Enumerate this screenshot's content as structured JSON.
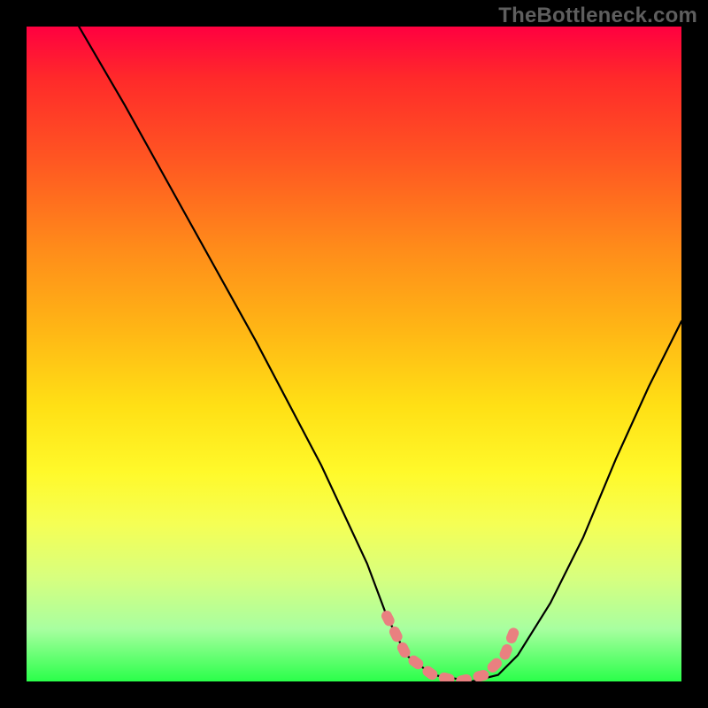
{
  "watermark": "TheBottleneck.com",
  "chart_data": {
    "type": "line",
    "title": "",
    "xlabel": "",
    "ylabel": "",
    "xlim": [
      0,
      100
    ],
    "ylim": [
      0,
      100
    ],
    "series": [
      {
        "name": "bottleneck-curve",
        "x": [
          8,
          15,
          25,
          35,
          45,
          52,
          55,
          58,
          62,
          68,
          72,
          75,
          80,
          85,
          90,
          95,
          100
        ],
        "y": [
          100,
          88,
          70,
          52,
          33,
          18,
          10,
          4,
          1,
          0,
          1,
          4,
          12,
          22,
          34,
          45,
          55
        ]
      },
      {
        "name": "optimal-range-marker",
        "x": [
          55,
          58,
          62,
          66,
          70,
          73,
          75
        ],
        "y": [
          10,
          4,
          1,
          0,
          1,
          4,
          9
        ]
      }
    ]
  },
  "colors": {
    "curve": "#000000",
    "marker": "#e98080",
    "gradient_top": "#ff0040",
    "gradient_bottom": "#2aff4a",
    "frame": "#000000"
  }
}
